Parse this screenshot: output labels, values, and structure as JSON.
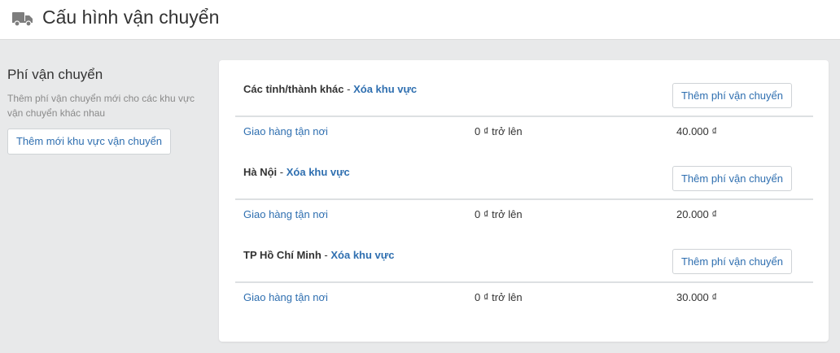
{
  "header": {
    "title": "Cấu hình vận chuyển",
    "icon": "truck-icon"
  },
  "sidebar": {
    "title": "Phí vận chuyển",
    "description": "Thêm phí vận chuyển mới cho các khu vực vận chuyển khác nhau",
    "add_zone_label": "Thêm mới khu vực vận chuyển"
  },
  "zones": [
    {
      "name": "Các tỉnh/thành khác",
      "separator": " - ",
      "remove_label": "Xóa khu vực",
      "add_fee_label": "Thêm phí vận chuyển",
      "rates": [
        {
          "name": "Giao hàng tận nơi",
          "condition": "0 ₫ trở lên",
          "price": "40.000 ₫"
        }
      ]
    },
    {
      "name": "Hà Nội",
      "separator": " - ",
      "remove_label": "Xóa khu vực",
      "add_fee_label": "Thêm phí vận chuyển",
      "rates": [
        {
          "name": "Giao hàng tận nơi",
          "condition": "0 ₫ trở lên",
          "price": "20.000 ₫"
        }
      ]
    },
    {
      "name": "TP Hồ Chí Minh",
      "separator": " - ",
      "remove_label": "Xóa khu vực",
      "add_fee_label": "Thêm phí vận chuyển",
      "rates": [
        {
          "name": "Giao hàng tận nơi",
          "condition": "0 ₫ trở lên",
          "price": "30.000 ₫"
        }
      ]
    }
  ],
  "colors": {
    "background": "#e8e9ea",
    "accent": "#2f6fb0",
    "muted_text": "#8a8a8a"
  }
}
